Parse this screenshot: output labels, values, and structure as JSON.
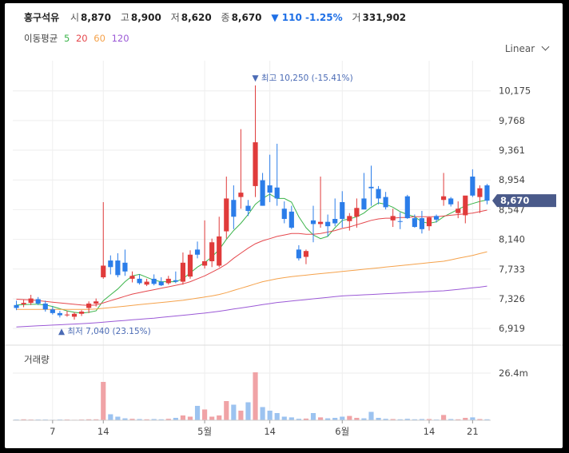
{
  "header": {
    "name": "흥구석유",
    "open_label": "시",
    "open_value": "8,870",
    "high_label": "고",
    "high_value": "8,900",
    "low_label": "저",
    "low_value": "8,620",
    "close_label": "종",
    "close_value": "8,670",
    "change": "▼ 110 -1.25%",
    "volume_label": "거",
    "volume_value": "331,902"
  },
  "moving_avg": {
    "label": "이동평균",
    "periods": [
      {
        "label": "5",
        "color": "#3cb44b"
      },
      {
        "label": "20",
        "color": "#e5484d"
      },
      {
        "label": "60",
        "color": "#f5a24b"
      },
      {
        "label": "120",
        "color": "#9b59d6"
      }
    ]
  },
  "scale_label": "Linear",
  "annotations": {
    "high": "▼ 최고 10,250 (-15.41%)",
    "low": "▲ 최저 7,040 (23.15%)"
  },
  "current_price_tag": "8,670",
  "volume_title": "거래량",
  "chart_data": [
    {
      "type": "candlestick",
      "yticks": [
        10175,
        9768,
        9361,
        8954,
        8547,
        8140,
        7733,
        7326,
        6919
      ],
      "ytick_labels": [
        "10,175",
        "9,768",
        "9,361",
        "8,954",
        "8,547",
        "8,140",
        "7,733",
        "7,326",
        "6,919"
      ],
      "ylim": [
        6800,
        10500
      ],
      "xtick_labels": [
        "7",
        "14",
        "5월",
        "14",
        "6월",
        "14",
        "21"
      ],
      "colors": {
        "up": "#e03b3b",
        "down": "#2b7de9"
      },
      "candles": [
        [
          7240,
          7300,
          7170,
          7200
        ],
        [
          7250,
          7310,
          7210,
          7270
        ],
        [
          7270,
          7380,
          7240,
          7330
        ],
        [
          7320,
          7350,
          7240,
          7260
        ],
        [
          7260,
          7300,
          7150,
          7180
        ],
        [
          7180,
          7220,
          7110,
          7130
        ],
        [
          7130,
          7160,
          7070,
          7100
        ],
        [
          7100,
          7160,
          7080,
          7110
        ],
        [
          7080,
          7140,
          7040,
          7120
        ],
        [
          7120,
          7170,
          7090,
          7150
        ],
        [
          7200,
          7290,
          7130,
          7260
        ],
        [
          7260,
          7330,
          7220,
          7290
        ],
        [
          7620,
          8650,
          7600,
          7780
        ],
        [
          7850,
          7920,
          7660,
          7760
        ],
        [
          7850,
          7950,
          7620,
          7650
        ],
        [
          7820,
          8000,
          7640,
          7700
        ],
        [
          7600,
          7700,
          7550,
          7640
        ],
        [
          7600,
          7660,
          7520,
          7540
        ],
        [
          7520,
          7600,
          7500,
          7560
        ],
        [
          7600,
          7660,
          7510,
          7530
        ],
        [
          7560,
          7620,
          7500,
          7510
        ],
        [
          7540,
          7640,
          7520,
          7600
        ],
        [
          7580,
          7700,
          7540,
          7560
        ],
        [
          7560,
          7960,
          7520,
          7820
        ],
        [
          7630,
          7990,
          7600,
          7930
        ],
        [
          8000,
          8110,
          7880,
          7930
        ],
        [
          7780,
          8400,
          7740,
          7840
        ],
        [
          7840,
          8150,
          7760,
          8100
        ],
        [
          7780,
          8450,
          7760,
          8180
        ],
        [
          8250,
          9000,
          8150,
          8700
        ],
        [
          8680,
          8880,
          8280,
          8450
        ],
        [
          8720,
          9650,
          8560,
          8780
        ],
        [
          8600,
          8680,
          8460,
          8530
        ],
        [
          8870,
          10250,
          8720,
          9470
        ],
        [
          8950,
          9050,
          8600,
          8600
        ],
        [
          8880,
          9300,
          8650,
          8780
        ],
        [
          8850,
          9450,
          8600,
          8700
        ],
        [
          8560,
          8660,
          8360,
          8420
        ],
        [
          8520,
          8600,
          8280,
          8300
        ],
        [
          8000,
          8060,
          7850,
          7880
        ],
        [
          7900,
          8000,
          7800,
          7980
        ],
        [
          8400,
          8600,
          8100,
          8350
        ],
        [
          8350,
          9000,
          8300,
          8380
        ],
        [
          8380,
          8480,
          8180,
          8320
        ],
        [
          8420,
          8700,
          8320,
          8360
        ],
        [
          8650,
          8800,
          8300,
          8420
        ],
        [
          8390,
          8500,
          8260,
          8460
        ],
        [
          8450,
          8700,
          8300,
          8570
        ],
        [
          8700,
          9050,
          8550,
          8550
        ],
        [
          8860,
          9150,
          8600,
          8840
        ],
        [
          8830,
          8870,
          8620,
          8700
        ],
        [
          8720,
          8790,
          8550,
          8580
        ],
        [
          8400,
          8560,
          8310,
          8460
        ],
        [
          8390,
          8510,
          8280,
          8380
        ],
        [
          8730,
          8750,
          8420,
          8430
        ],
        [
          8430,
          8480,
          8300,
          8310
        ],
        [
          8430,
          8530,
          8220,
          8280
        ],
        [
          8320,
          8450,
          8260,
          8440
        ],
        [
          8460,
          8480,
          8370,
          8410
        ],
        [
          8680,
          9050,
          8600,
          8730
        ],
        [
          8700,
          8720,
          8590,
          8620
        ],
        [
          8500,
          8660,
          8430,
          8560
        ],
        [
          8470,
          8720,
          8360,
          8740
        ],
        [
          9000,
          9100,
          8720,
          8740
        ],
        [
          8720,
          8880,
          8500,
          8840
        ],
        [
          8880,
          8900,
          8620,
          8670
        ]
      ],
      "ma_series": [
        {
          "name": "5",
          "color": "#3cb44b",
          "values": [
            7240,
            7245,
            7250,
            7250,
            7240,
            7220,
            7190,
            7160,
            7140,
            7130,
            7140,
            7160,
            7300,
            7380,
            7460,
            7560,
            7640,
            7660,
            7620,
            7580,
            7560,
            7560,
            7560,
            7600,
            7680,
            7760,
            7820,
            7900,
            8000,
            8140,
            8260,
            8360,
            8480,
            8620,
            8700,
            8760,
            8700,
            8700,
            8650,
            8450,
            8300,
            8200,
            8150,
            8180,
            8300,
            8400,
            8420,
            8450,
            8500,
            8580,
            8640,
            8620,
            8580,
            8520,
            8480,
            8450,
            8380,
            8360,
            8380,
            8450,
            8500,
            8550,
            8600,
            8630,
            8660,
            8680
          ]
        },
        {
          "name": "20",
          "color": "#e5484d",
          "values": [
            7320,
            7315,
            7310,
            7300,
            7290,
            7280,
            7270,
            7260,
            7250,
            7240,
            7235,
            7240,
            7270,
            7300,
            7330,
            7360,
            7390,
            7410,
            7430,
            7450,
            7470,
            7490,
            7510,
            7530,
            7560,
            7600,
            7640,
            7690,
            7740,
            7800,
            7880,
            7950,
            8020,
            8080,
            8120,
            8150,
            8180,
            8200,
            8220,
            8220,
            8210,
            8210,
            8220,
            8240,
            8260,
            8290,
            8310,
            8340,
            8370,
            8400,
            8420,
            8430,
            8430,
            8440,
            8440,
            8450,
            8450,
            8450,
            8450,
            8460,
            8470,
            8480,
            8490,
            8500,
            8520,
            8540
          ]
        },
        {
          "name": "60",
          "color": "#f5a24b",
          "values": [
            7180,
            7180,
            7180,
            7180,
            7180,
            7180,
            7180,
            7180,
            7180,
            7180,
            7180,
            7185,
            7195,
            7205,
            7215,
            7225,
            7235,
            7245,
            7255,
            7265,
            7275,
            7285,
            7295,
            7305,
            7320,
            7335,
            7350,
            7365,
            7385,
            7410,
            7440,
            7470,
            7500,
            7530,
            7560,
            7580,
            7600,
            7615,
            7630,
            7640,
            7650,
            7660,
            7670,
            7680,
            7690,
            7700,
            7710,
            7720,
            7730,
            7740,
            7750,
            7760,
            7770,
            7780,
            7790,
            7800,
            7810,
            7820,
            7830,
            7840,
            7860,
            7880,
            7900,
            7920,
            7945,
            7970
          ]
        },
        {
          "name": "120",
          "color": "#9b59d6",
          "values": [
            6940,
            6945,
            6950,
            6955,
            6960,
            6965,
            6970,
            6975,
            6980,
            6985,
            6990,
            6997,
            7005,
            7013,
            7021,
            7029,
            7037,
            7045,
            7053,
            7061,
            7070,
            7080,
            7090,
            7100,
            7110,
            7120,
            7130,
            7142,
            7155,
            7170,
            7185,
            7200,
            7215,
            7230,
            7245,
            7260,
            7275,
            7285,
            7295,
            7305,
            7315,
            7325,
            7335,
            7345,
            7355,
            7365,
            7370,
            7375,
            7380,
            7385,
            7390,
            7395,
            7400,
            7405,
            7410,
            7415,
            7420,
            7425,
            7430,
            7435,
            7445,
            7455,
            7465,
            7475,
            7485,
            7500
          ]
        }
      ]
    },
    {
      "type": "bar",
      "title": "거래량",
      "ytick_labels": [
        "26.4m"
      ],
      "ylim": [
        0,
        30
      ],
      "values": [
        0.3,
        0.4,
        0.3,
        0.3,
        0.3,
        0.2,
        0.3,
        0.3,
        0.2,
        0.3,
        0.4,
        0.4,
        16.0,
        2.5,
        1.5,
        0.8,
        0.6,
        0.5,
        0.4,
        0.5,
        0.4,
        0.6,
        1.0,
        2.0,
        1.5,
        6.0,
        4.5,
        1.5,
        2.0,
        8.0,
        6.5,
        4.0,
        7.5,
        20.0,
        5.5,
        4.0,
        3.0,
        1.5,
        1.2,
        0.6,
        0.7,
        3.0,
        1.2,
        0.8,
        1.0,
        1.5,
        1.8,
        1.0,
        0.8,
        3.5,
        1.0,
        0.6,
        0.5,
        0.4,
        0.6,
        0.4,
        0.5,
        0.5,
        0.3,
        2.2,
        0.5,
        0.4,
        1.0,
        1.2,
        0.5,
        0.4
      ]
    }
  ]
}
